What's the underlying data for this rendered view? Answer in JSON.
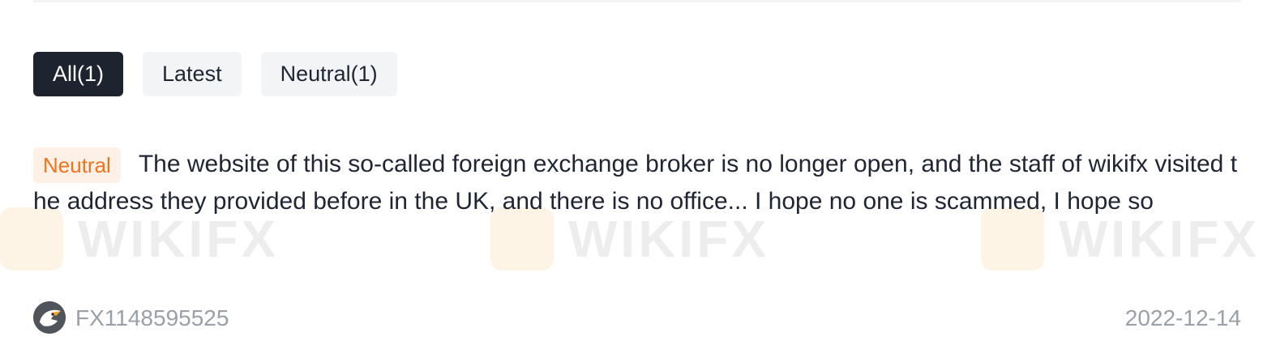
{
  "filters": {
    "tabs": [
      {
        "label": "All(1)",
        "active": true
      },
      {
        "label": "Latest",
        "active": false
      },
      {
        "label": "Neutral(1)",
        "active": false
      }
    ]
  },
  "review": {
    "tag": "Neutral",
    "text": "The website of this so-called foreign exchange broker is no longer open, and the staff of wikifx visited the address they provided before in the UK, and there is no office... I hope no one is scammed, I hope so"
  },
  "watermark": {
    "text": "WIKIFX"
  },
  "footer": {
    "avatar_icon": "eagle-avatar-icon",
    "username": "FX1148595525",
    "date": "2022-12-14"
  },
  "colors": {
    "active_tab_bg": "#1e2330",
    "tab_bg": "#f3f4f6",
    "tag_text": "#f0741e",
    "tag_bg": "#fdf0e6",
    "meta_text": "#9aa0a8"
  }
}
